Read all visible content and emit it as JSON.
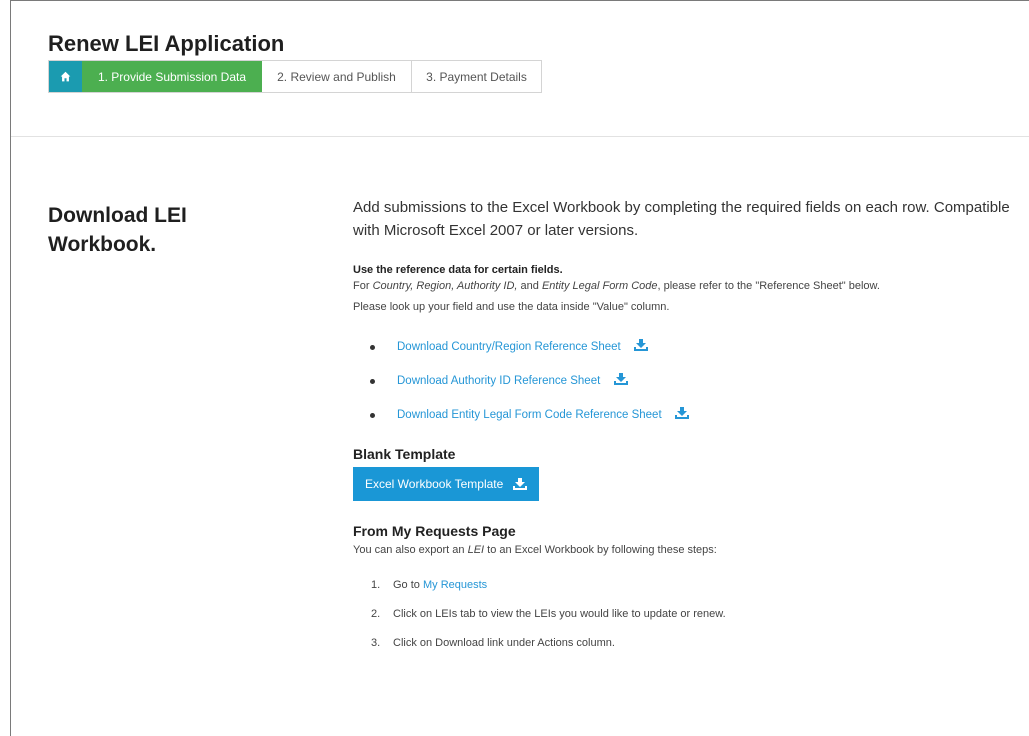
{
  "header": {
    "title": "Renew LEI Application",
    "steps": [
      {
        "label": "1. Provide Submission Data"
      },
      {
        "label": "2. Review and Publish"
      },
      {
        "label": "3. Payment Details"
      }
    ]
  },
  "section": {
    "heading": "Download LEI Workbook.",
    "lead": "Add submissions to the Excel Workbook by completing the required fields on each row. Compatible with Microsoft Excel 2007 or later versions.",
    "reference_title": "Use the reference data for certain fields.",
    "reference_line_prefix": "For ",
    "reference_fields": [
      "Country, Region, Authority ID,",
      "Entity Legal Form Code"
    ],
    "reference_line_and": " and ",
    "reference_line_suffix": ", please refer to the \"Reference Sheet\" below.",
    "reference_line_2": "Please look up your field and use the data inside \"Value\" column.",
    "reference_links": [
      "Download Country/Region Reference Sheet",
      "Download Authority ID Reference Sheet",
      "Download Entity Legal Form Code Reference Sheet"
    ],
    "blank_template_title": "Blank Template",
    "template_button": "Excel Workbook Template",
    "requests_title": "From My Requests Page",
    "export_prefix": "You can also export an ",
    "export_term": "LEI",
    "export_suffix": " to an Excel Workbook by following these steps:",
    "steps": [
      {
        "num": "1.",
        "prefix": "Go to ",
        "link": "My Requests",
        "text": ""
      },
      {
        "num": "2.",
        "prefix": "",
        "link": "",
        "text": "Click on LEIs tab to view the LEIs you would like to update or renew."
      },
      {
        "num": "3.",
        "prefix": "",
        "link": "",
        "text": "Click on Download link under Actions column."
      }
    ]
  },
  "colors": {
    "home_step": "#1b9bb0",
    "active_step": "#4caf50",
    "link": "#2596d6",
    "button": "#1a97d6"
  },
  "icons": {
    "home": "home-icon",
    "download": "download-icon"
  }
}
